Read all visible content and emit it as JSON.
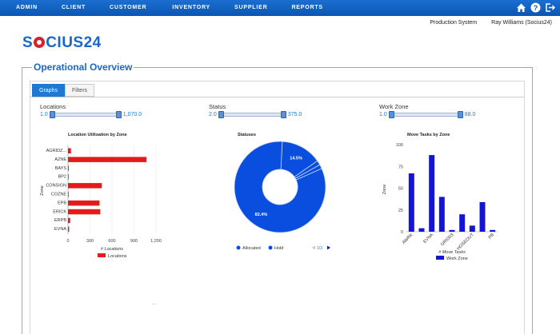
{
  "nav": {
    "items": [
      "ADMIN",
      "CLIENT",
      "CUSTOMER",
      "INVENTORY",
      "SUPPLIER",
      "REPORTS"
    ]
  },
  "user_bar": {
    "system": "Production System",
    "user": "Ray Williams (Socius24)"
  },
  "logo": {
    "before": "S",
    "after": "CIUS24"
  },
  "page": {
    "title": "Operational Overview"
  },
  "tabs": [
    {
      "label": "Graphs",
      "active": true
    },
    {
      "label": "Filters",
      "active": false
    }
  ],
  "sliders": {
    "locations": {
      "label": "Locations",
      "min": "1.0",
      "max": "1,070.0"
    },
    "status": {
      "label": "Status",
      "min": "2.0",
      "max": "375.0"
    },
    "work_zone": {
      "label": "Work Zone",
      "min": "1.0",
      "max": "88.0"
    }
  },
  "colors": {
    "accent": "#1f78d1",
    "red": "#e41a1c",
    "blue": "#1414d6",
    "pie": "#0a4ee0"
  },
  "chart_data": [
    {
      "type": "bar",
      "orientation": "horizontal",
      "title": "Location Utilisation by Zone",
      "xlabel": "# Locations",
      "ylabel": "Zone",
      "categories": [
        "AGRIDZ...",
        "AZNE",
        "BAYS",
        "BP2",
        "CONSIGN",
        "COZNE",
        "EPB",
        "ERICK",
        "ERPB",
        "EVNA"
      ],
      "values": [
        40,
        1070,
        10,
        3,
        460,
        3,
        430,
        440,
        30,
        15
      ],
      "xticks": [
        "0",
        "300",
        "600",
        "900",
        "1,200"
      ],
      "xlim": [
        0,
        1200
      ],
      "legend": [
        "Locations"
      ],
      "color": "#e41a1c"
    },
    {
      "type": "pie",
      "title": "Statuses",
      "slices": [
        {
          "label": "Allocated",
          "value": 82.4
        },
        {
          "label": "Hold",
          "value": 14.5
        },
        {
          "label": "",
          "value": 1.6
        },
        {
          "label": "",
          "value": 1.5
        }
      ],
      "data_labels": [
        "82.4%",
        "14.5%"
      ],
      "legend": [
        "Allocated",
        "Hold"
      ],
      "legend_page": "1/3",
      "color": "#0a4ee0"
    },
    {
      "type": "bar",
      "title": "Move Tasks by Zone",
      "xlabel": "# Move Tasks",
      "ylabel": "Zone",
      "categories": [
        "AWRK",
        "",
        "EVNA",
        "",
        "GRID03",
        "",
        "HOSEOUT",
        "",
        "PB",
        ""
      ],
      "values": [
        67,
        4,
        88,
        40,
        2,
        20,
        7,
        34,
        2
      ],
      "yticks": [
        "0",
        "25",
        "50",
        "75",
        "100"
      ],
      "ylim": [
        0,
        100
      ],
      "legend": [
        "Work Zone"
      ],
      "color": "#1414d6"
    }
  ]
}
